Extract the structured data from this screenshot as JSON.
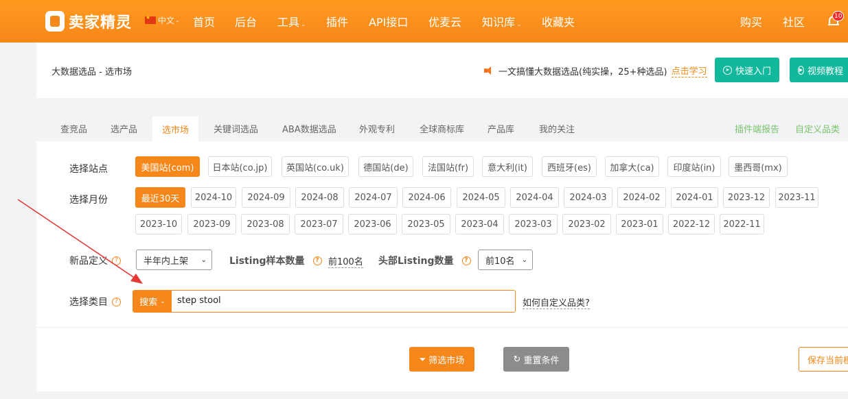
{
  "nav": {
    "logo_text": "卖家精灵",
    "language": "中文",
    "items": [
      {
        "label": "首页",
        "chevron": false
      },
      {
        "label": "后台",
        "chevron": false
      },
      {
        "label": "工具",
        "chevron": true
      },
      {
        "label": "插件",
        "chevron": false
      },
      {
        "label": "API接口",
        "chevron": false
      },
      {
        "label": "优麦云",
        "chevron": false
      },
      {
        "label": "知识库",
        "chevron": true
      },
      {
        "label": "收藏夹",
        "chevron": false
      }
    ],
    "right_items": [
      "购买",
      "社区"
    ],
    "notification_count": "10"
  },
  "header": {
    "title": "大数据选品 - 选市场",
    "notice": "一文搞懂大数据选品(纯实操，25+种选品)",
    "learn_link": "点击学习",
    "quick_start": "快速入门",
    "video_tutorial": "视频教程"
  },
  "tabs": [
    "查竞品",
    "选产品",
    "选市场",
    "关键词选品",
    "ABA数据选品",
    "外观专利",
    "全球商标库",
    "产品库",
    "我的关注"
  ],
  "active_tab": "选市场",
  "tabs_right": [
    "插件端报告",
    "自定义品类"
  ],
  "filters": {
    "site_label": "选择站点",
    "sites": [
      "美国站(com)",
      "日本站(co.jp)",
      "英国站(co.uk)",
      "德国站(de)",
      "法国站(fr)",
      "意大利(it)",
      "西班牙(es)",
      "加拿大(ca)",
      "印度站(in)",
      "墨西哥(mx)"
    ],
    "month_label": "选择月份",
    "months": [
      "最近30天",
      "2024-10",
      "2024-09",
      "2024-08",
      "2024-07",
      "2024-06",
      "2024-05",
      "2024-04",
      "2024-03",
      "2024-02",
      "2024-01",
      "2023-12",
      "2023-11",
      "2023-10",
      "2023-09",
      "2023-08",
      "2023-07",
      "2023-06",
      "2023-05",
      "2023-04",
      "2023-03",
      "2023-02",
      "2023-01",
      "2022-12",
      "2022-11"
    ],
    "new_product_label": "新品定义",
    "new_product_value": "半年内上架",
    "listing_sample_label": "Listing样本数量",
    "listing_sample_value": "前100名",
    "head_listing_label": "头部Listing数量",
    "head_listing_value": "前10名",
    "category_label": "选择类目",
    "search_button": "搜索",
    "search_value": "step stool",
    "custom_category_link": "如何自定义品类?"
  },
  "actions": {
    "filter_market": "筛选市场",
    "reset": "重置条件",
    "save": "保存当前模板"
  },
  "colors": {
    "brand_orange": "#f6871a",
    "green": "#12b89c",
    "reset_gray": "#8c8c8c",
    "annotation_arrow": "#e53935"
  }
}
